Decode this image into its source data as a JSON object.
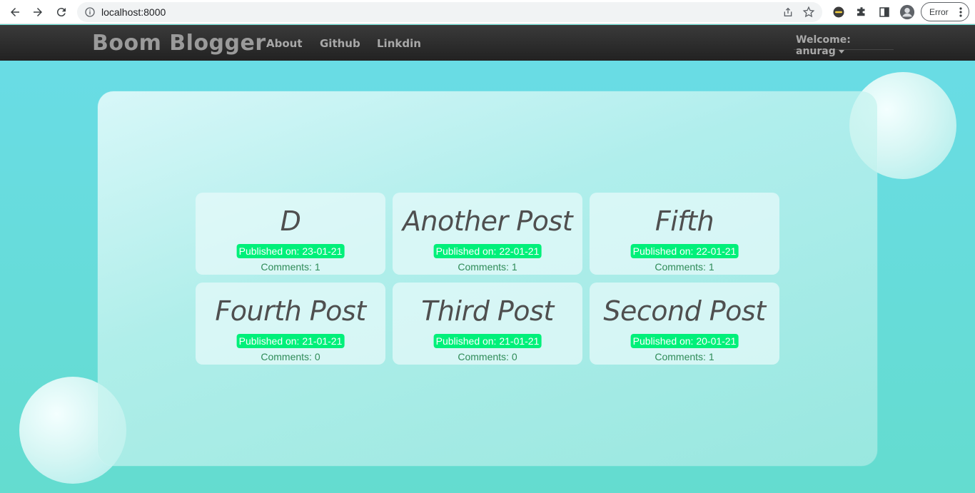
{
  "browser": {
    "url": "localhost:8000",
    "error_label": "Error"
  },
  "navbar": {
    "brand": "Boom Blogger",
    "links": [
      "About",
      "Github",
      "Linkdin"
    ],
    "welcome": "Welcome: anurag"
  },
  "colors": {
    "badge": "#00f07a",
    "comments": "#2e8b57",
    "background": "#62dccf"
  },
  "posts": [
    {
      "title": "D",
      "published": "Published on: 23-01-21",
      "comments": "Comments: 1"
    },
    {
      "title": "Another Post",
      "published": "Published on: 22-01-21",
      "comments": "Comments: 1"
    },
    {
      "title": "Fifth",
      "published": "Published on: 22-01-21",
      "comments": "Comments: 1"
    },
    {
      "title": "Fourth Post",
      "published": "Published on: 21-01-21",
      "comments": "Comments: 0"
    },
    {
      "title": "Third Post",
      "published": "Published on: 21-01-21",
      "comments": "Comments: 0"
    },
    {
      "title": "Second Post",
      "published": "Published on: 20-01-21",
      "comments": "Comments: 1"
    }
  ]
}
